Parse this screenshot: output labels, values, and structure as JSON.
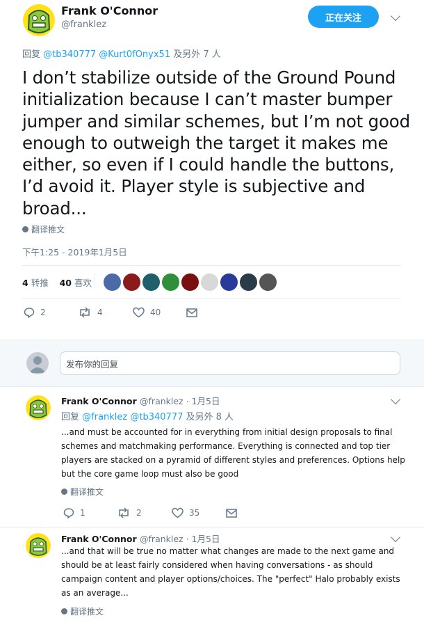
{
  "main": {
    "author_name": "Frank O'Connor",
    "author_handle": "@franklez",
    "follow_label": "正在关注",
    "reply_prefix": "回复",
    "mention_1": "@tb340777",
    "mention_2": "@Kurt0fOnyx51",
    "reply_suffix": "及另外 7 人",
    "text": "I don’t stabilize outside of the Ground Pound initialization because I can’t master bumper jumper and similar schemes, but I’m not good enough to outweigh the target it makes me either, so even if I could handle the buttons, I’d avoid it. Player style is subjective and broad...",
    "translate_label": "翻译推文",
    "timestamp": "下午1:25 - 2019年1月5日",
    "retweets_count": "4",
    "retweets_label": "转推",
    "likes_count": "40",
    "likes_label": "喜欢",
    "action_reply_count": "2",
    "action_retweet_count": "4",
    "action_like_count": "40"
  },
  "composer": {
    "placeholder": "发布你的回复"
  },
  "replies": [
    {
      "name": "Frank O'Connor",
      "handle_date": "@franklez · 1月5日",
      "reply_prefix": "回复",
      "mention_1": "@franklez",
      "mention_2": "@tb340777",
      "reply_suffix": "及另外 8 人",
      "text": "...and must be accounted for in everything from initial design proposals to final schemes and matchmaking performance. Everything is connected and top tier players are stacked on a pyramid of different styles and preferences. Options help but the core game loop must also be good",
      "translate_label": "翻译推文",
      "reply_count": "1",
      "retweet_count": "2",
      "like_count": "35"
    },
    {
      "name": "Frank O'Connor",
      "handle_date": "@franklez · 1月5日",
      "text": "...and that will be true no matter what changes are made to the next game and should be at least fairly considered when having conversations - as should campaign content and player options/choices. The \"perfect\" Halo probably exists as an average...",
      "translate_label": "翻译推文"
    }
  ],
  "colors": {
    "accent": "#1da1f2",
    "secondary_text": "#657786",
    "avatar_green": "#8dc63f"
  }
}
